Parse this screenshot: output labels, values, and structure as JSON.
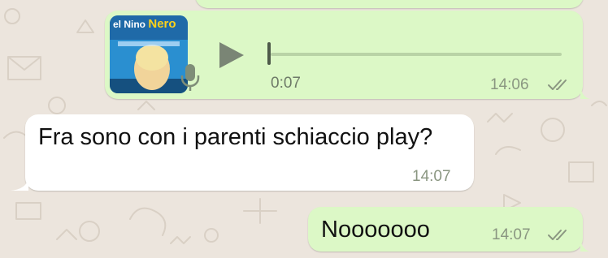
{
  "colors": {
    "chat_background": "#ece5dd",
    "outgoing_bubble": "#dcf8c6",
    "incoming_bubble": "#ffffff",
    "read_ticks": "#8a9681"
  },
  "messages": [
    {
      "type": "voice",
      "direction": "outgoing",
      "cover_title_1": "el Nino",
      "cover_title_2": "Nero",
      "duration": "0:07",
      "time": "14:06",
      "status_icon": "double-check-icon",
      "progress_fraction": 0
    },
    {
      "type": "text",
      "direction": "incoming",
      "text": "Fra sono con i parenti schiaccio play?",
      "time": "14:07"
    },
    {
      "type": "text",
      "direction": "outgoing",
      "text": "Nooooooo",
      "time": "14:07",
      "status_icon": "double-check-icon"
    }
  ]
}
